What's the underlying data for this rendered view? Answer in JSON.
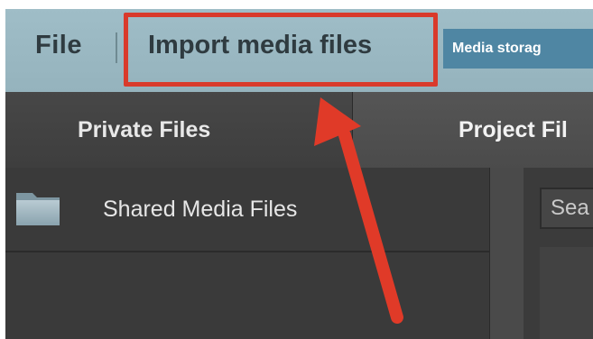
{
  "menubar": {
    "file_label": "File",
    "import_label": "Import media files",
    "media_storage_label": "Media storag"
  },
  "tabs": [
    {
      "label": "Private Files"
    },
    {
      "label": "Project Fil"
    }
  ],
  "folders": [
    {
      "label": "Shared Media Files",
      "icon": "folder-icon"
    }
  ],
  "search": {
    "placeholder": "Sea"
  },
  "colors": {
    "menubar_bg": "#9fbdc7",
    "highlight": "#d93a2b",
    "arrow": "#e03a28",
    "storage_button": "#4f86a3",
    "panel_dark": "#3a3a3a"
  }
}
